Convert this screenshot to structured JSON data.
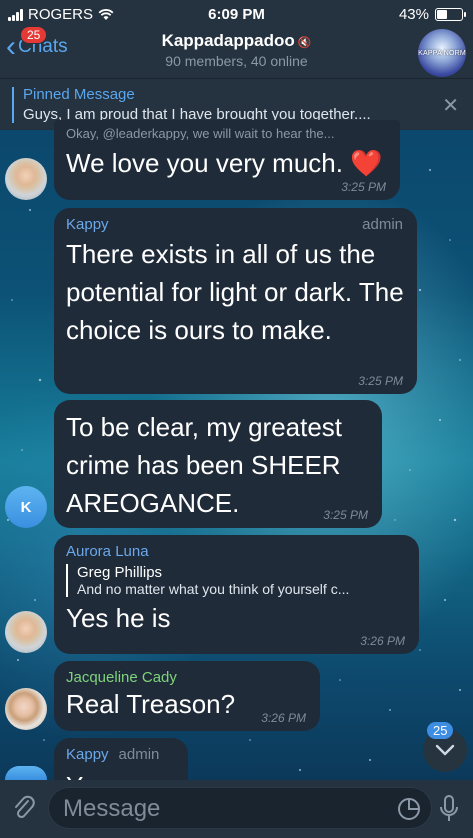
{
  "status_bar": {
    "carrier": "ROGERS",
    "time": "6:09 PM",
    "battery": "43%",
    "battery_level": 0.43
  },
  "header": {
    "back_label": "Chats",
    "unread_badge": "25",
    "title": "Kappadappadoo",
    "subtitle": "90 members, 40 online",
    "avatar_text": "KAPPA NORM"
  },
  "pinned": {
    "title": "Pinned Message",
    "text": "Guys, I am proud that I have brought you together...."
  },
  "messages": [
    {
      "partial_quote": "Okay, @leaderkappy, we will wait to hear the...",
      "text": "We love you very much. ❤️",
      "time": "3:25 PM"
    },
    {
      "sender": "Kappy",
      "role": "admin",
      "text": "There exists in all of us the potential for light or dark. The choice is ours to make.",
      "time": "3:25 PM"
    },
    {
      "avatar_initial": "K",
      "text": "To be clear, my greatest crime has been SHEER AREOGANCE.",
      "time": "3:25 PM"
    },
    {
      "sender": "Aurora Luna",
      "quote_name": "Greg Phillips",
      "quote_text": "And no matter what you think of yourself c...",
      "text": "Yes he is",
      "time": "3:26 PM"
    },
    {
      "sender": "Jacqueline Cady",
      "text": "Real Treason?",
      "time": "3:26 PM"
    },
    {
      "sender": "Kappy",
      "role": "admin",
      "text": "Yes"
    }
  ],
  "scroll_badge": "25",
  "input": {
    "placeholder": "Message"
  },
  "colors": {
    "accent": "#5aa7ef",
    "bubble": "#1f2b38",
    "bar": "#25323f",
    "sender_blue": "#6aa8ec",
    "sender_green": "#7fd37c",
    "sender_purple": "#b48cf0",
    "badge_red": "#e53935"
  }
}
